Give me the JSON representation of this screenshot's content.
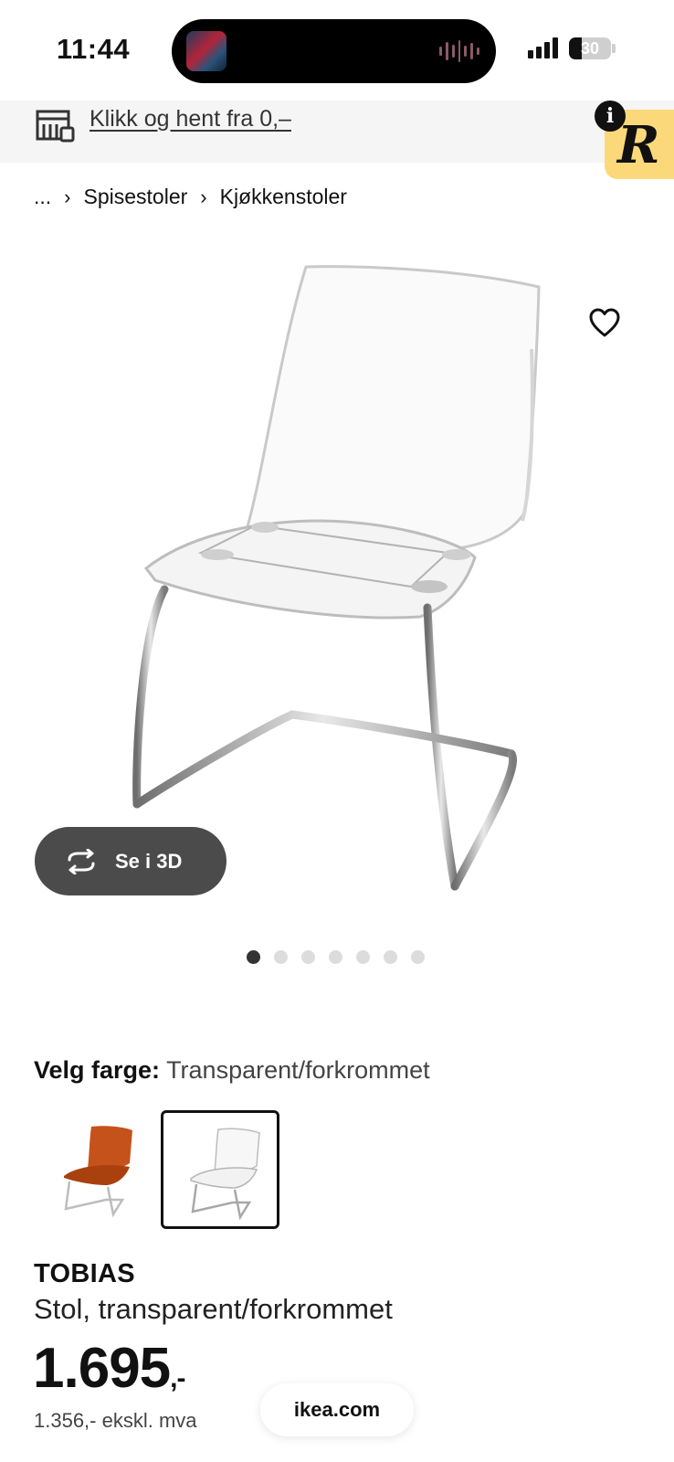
{
  "status_bar": {
    "time": "11:44",
    "battery": "30"
  },
  "banner": {
    "link_text": "Klikk og hent fra 0,–"
  },
  "badge": {
    "letter": "R",
    "info": "i"
  },
  "breadcrumb": {
    "items": [
      "...",
      "Spisestoler",
      "Kjøkkenstoler"
    ],
    "separator": "›"
  },
  "gallery": {
    "view_3d_label": "Se i 3D",
    "dot_count": 7,
    "active_index": 0
  },
  "color": {
    "label": "Velg farge:",
    "selected": "Transparent/forkrommet",
    "options": [
      {
        "name": "orange",
        "color": "#c6521b",
        "selected": false
      },
      {
        "name": "transparent",
        "color": "#f2f2f2",
        "selected": true
      }
    ]
  },
  "product": {
    "name": "TOBIAS",
    "description": "Stol, transparent/forkrommet",
    "price": "1.695",
    "price_suffix": ",-",
    "price_ex_vat": "1.356,- ekskl. mva"
  },
  "browser": {
    "url": "ikea.com"
  },
  "icons": {
    "store": "store-icon",
    "favourite": "heart-icon",
    "rotate": "rotate-3d-icon"
  }
}
